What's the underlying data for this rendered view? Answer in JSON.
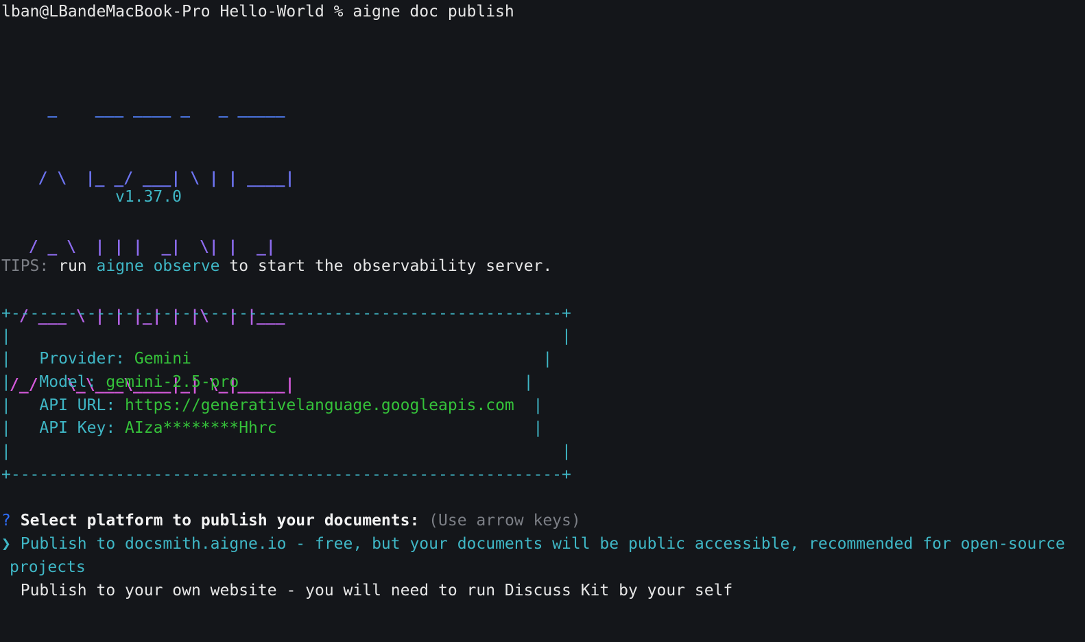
{
  "prompt": {
    "text": "lban@LBandeMacBook-Pro Hello-World % aigne doc publish"
  },
  "logo": {
    "rows": [
      "    _    ___ ____ _   _ _____",
      "   / \\  |_ _/ ___| \\ | | ____|",
      "  / _ \\  | | |  _|  \\| |  _|",
      " / ___ \\ | | |_| | |\\  | |___",
      "/_/   \\_\\___\\____|_| \\_|_____|"
    ],
    "colors": [
      "#4f7cf0",
      "#6d74f2",
      "#8d6cf0",
      "#b563e6",
      "#d65adc"
    ]
  },
  "version": "v1.37.0",
  "tips": {
    "label": "TIPS:",
    "before": " run ",
    "command": "aigne observe",
    "after": " to start the observability server."
  },
  "info_box": {
    "border_top": "+----------------------------------------------------------+",
    "border_bottom": "+----------------------------------------------------------+",
    "empty_row": "|                                                          |",
    "rows": [
      {
        "label": "Provider:",
        "value": "Gemini",
        "pad": "                                     |"
      },
      {
        "label": "Model:",
        "value": "gemini-2.5-pro",
        "pad": "                              |"
      },
      {
        "label": "API URL:",
        "value": "https://generativelanguage.googleapis.com",
        "pad": "  |"
      },
      {
        "label": "API Key:",
        "value": "AIza********Hhrc",
        "pad": "                           |"
      }
    ]
  },
  "question": {
    "mark": "?",
    "text": "Select platform to publish your documents:",
    "hint": "(Use arrow keys)"
  },
  "options": [
    {
      "pointer": "❯",
      "label": "Publish to docsmith.aigne.io - free, but your documents will be public accessible, recommended for open-source",
      "wrap": "projects",
      "selected": true
    },
    {
      "pointer": " ",
      "label": "Publish to your own website - you will need to run Discuss Kit by your self",
      "selected": false
    }
  ],
  "colors": {
    "background": "#14161a",
    "cyan": "#3fb7c6",
    "green": "#35c23a",
    "muted": "#7c7f86",
    "question_mark": "#2f6fff"
  }
}
